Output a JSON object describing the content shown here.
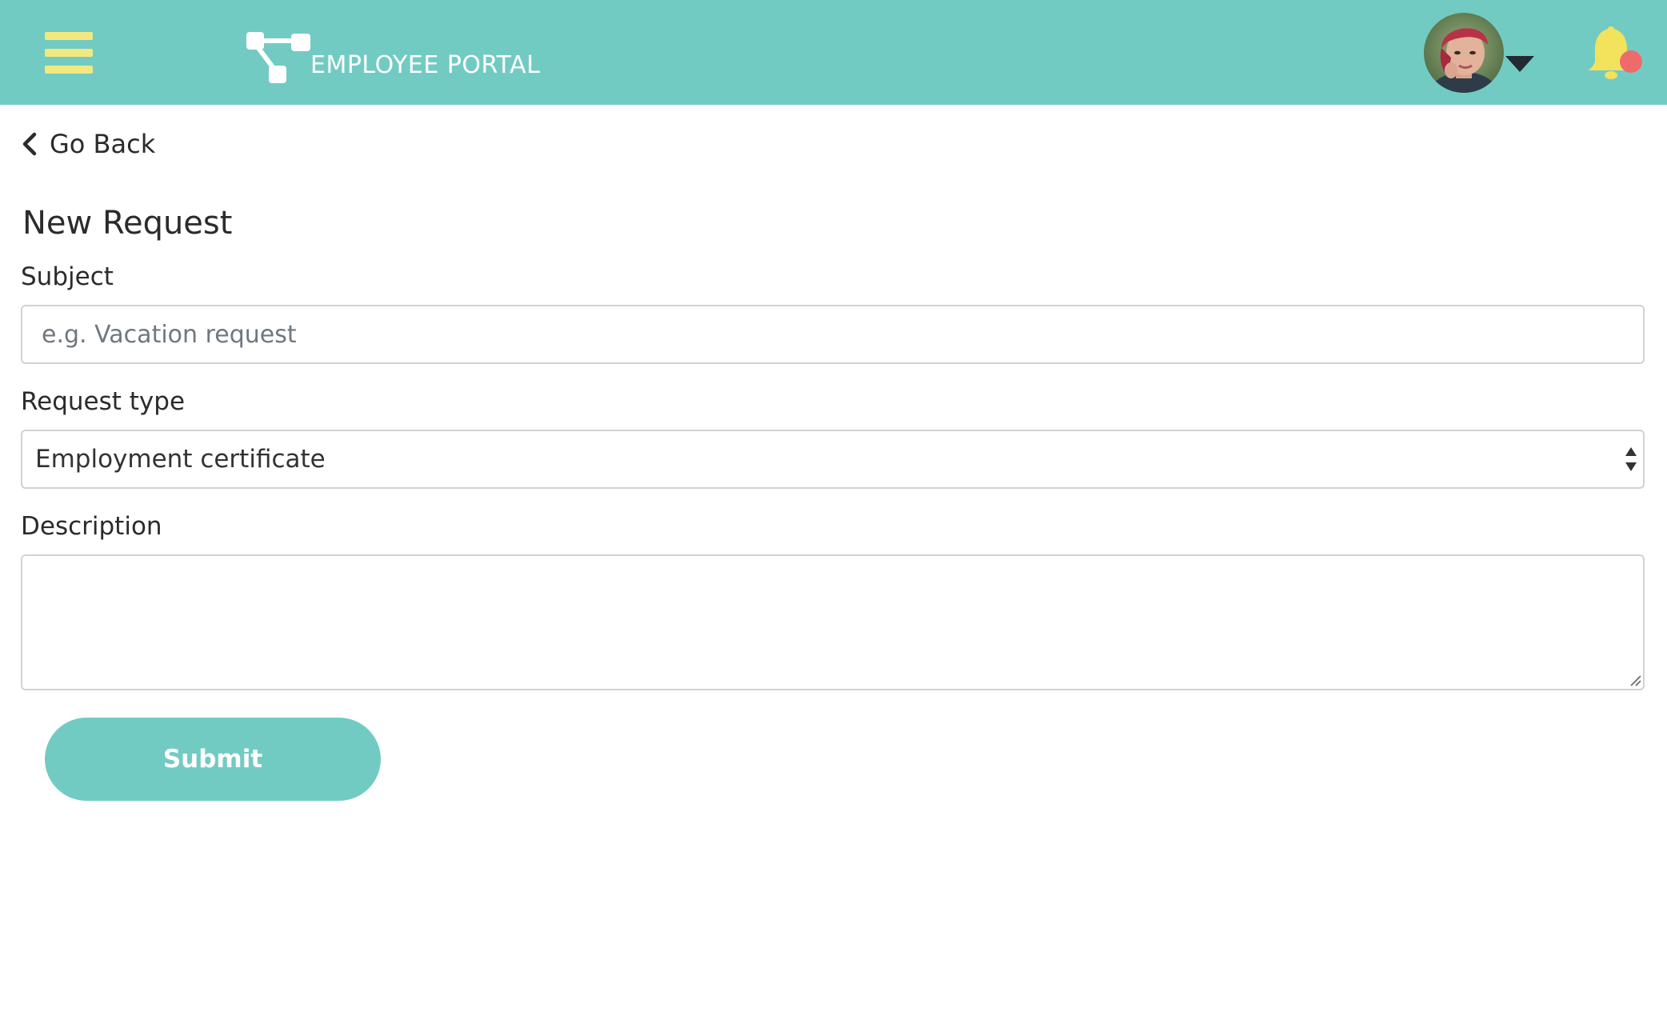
{
  "header": {
    "brand_title": "EMPLOYEE PORTAL",
    "background_color": "#72cbc3",
    "menu_icon": "hamburger-menu-icon",
    "menu_icon_color": "#f2e880",
    "logo_icon": "network-nodes-icon",
    "avatar": "user-avatar",
    "avatar_menu_icon": "caret-down-icon",
    "notification_icon": "bell-icon",
    "notification_dot_color": "#ef6b6b"
  },
  "nav": {
    "back_label": "Go Back",
    "back_icon": "chevron-left-icon"
  },
  "form": {
    "title": "New Request",
    "subject": {
      "label": "Subject",
      "value": "",
      "placeholder": "e.g. Vacation request"
    },
    "request_type": {
      "label": "Request type",
      "selected": "Employment certificate"
    },
    "description": {
      "label": "Description",
      "value": ""
    },
    "submit_label": "Submit",
    "accent_color": "#72cbc3"
  }
}
